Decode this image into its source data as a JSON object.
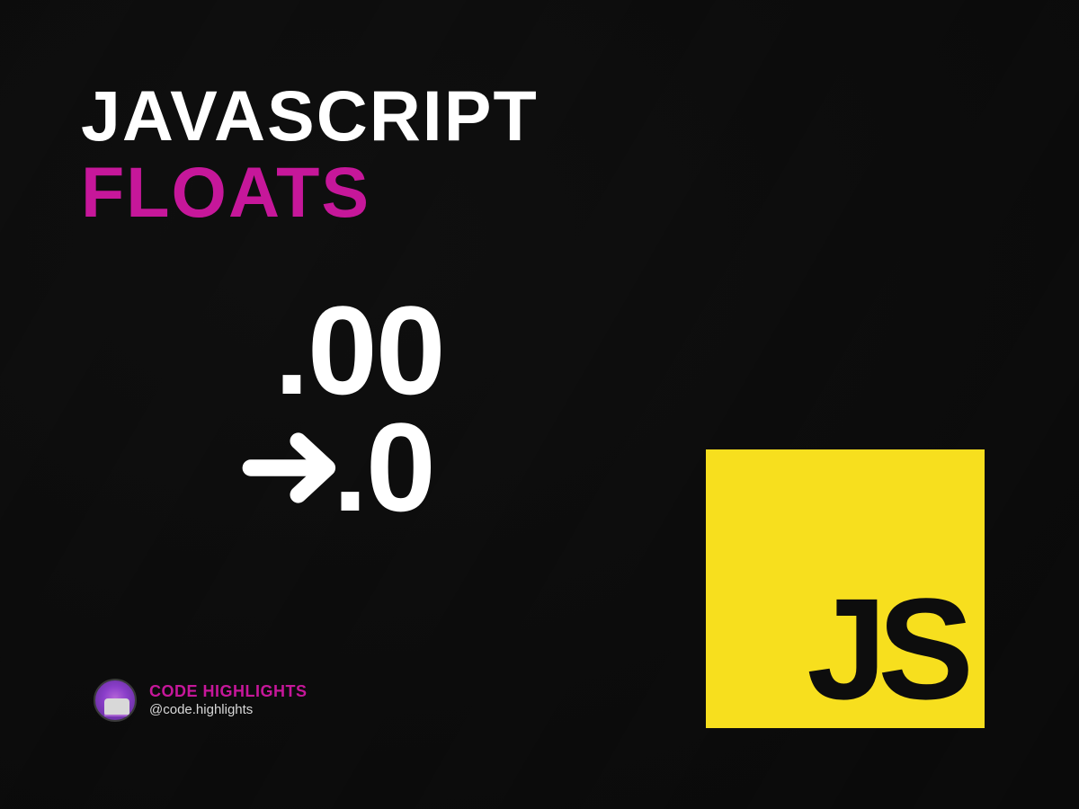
{
  "title": {
    "line1": "JAVASCRIPT",
    "line2": "FLOATS"
  },
  "graphic": {
    "top_value": ".00",
    "bottom_value": ".0",
    "arrow_name": "arrow-right"
  },
  "logo": {
    "text": "JS",
    "bg_color": "#f7df1e"
  },
  "brand": {
    "name": "CODE HIGHLIGHTS",
    "handle": "@code.highlights"
  }
}
